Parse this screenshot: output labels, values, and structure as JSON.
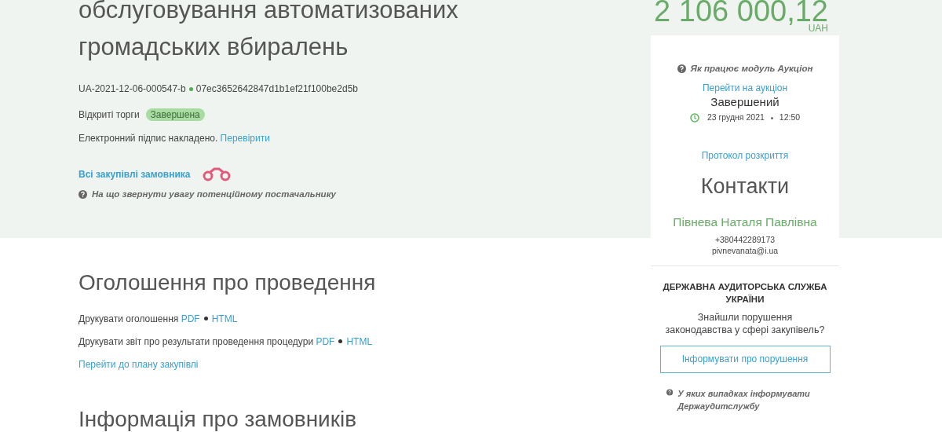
{
  "tender": {
    "title": "обслуговування автоматизованих громадських вбиралень",
    "tender_id": "UA-2021-12-06-000547-b",
    "hash": "07ec3652642847d1b1ef21f100be2d5b",
    "procedure_type": "Відкриті торги",
    "status_badge": "Завершена",
    "signature_text": "Електронний підпис накладено.",
    "signature_link": "Перевірити",
    "buyer_link": "Всі закупівлі замовника",
    "supplier_help": "На що звернути увагу потенційному постачальнику"
  },
  "sections": [
    {
      "heading": "Оголошення про проведення",
      "lines": [
        {
          "text": "Друкувати оголошення",
          "links": [
            "PDF",
            "HTML"
          ]
        },
        {
          "text": "Друкувати звіт про результати проведення процедури",
          "links": [
            "PDF",
            "HTML"
          ]
        },
        {
          "links": [
            "Перейти до плану закупівлі"
          ]
        }
      ]
    },
    {
      "heading": "Інформація про замовників"
    }
  ],
  "sidebar": {
    "amount": "2 106 000,12",
    "currency": "UAH",
    "auction_help": "Як працює модуль Аукціон",
    "auction_link": "Перейти на аукціон",
    "auction_status": "Завершений",
    "auction_date": "23 грудня 2021",
    "auction_time": "12:50",
    "protocol_link": "Протокол розкриття",
    "contacts_heading": "Контакти",
    "contact_name": "Півнева Наталя Павлівна",
    "contact_phone": "+380442289173",
    "contact_email": "pivnevanata@i.ua",
    "audit_heading": "ДЕРЖАВНА АУДИТОРСЬКА СЛУЖБА УКРАЇНИ",
    "audit_text": "Знайшли порушення законодавства у сфері закупівель?",
    "audit_button": "Інформувати про порушення",
    "audit_help": "У яких випадках інформувати Держаудитслужбу"
  }
}
